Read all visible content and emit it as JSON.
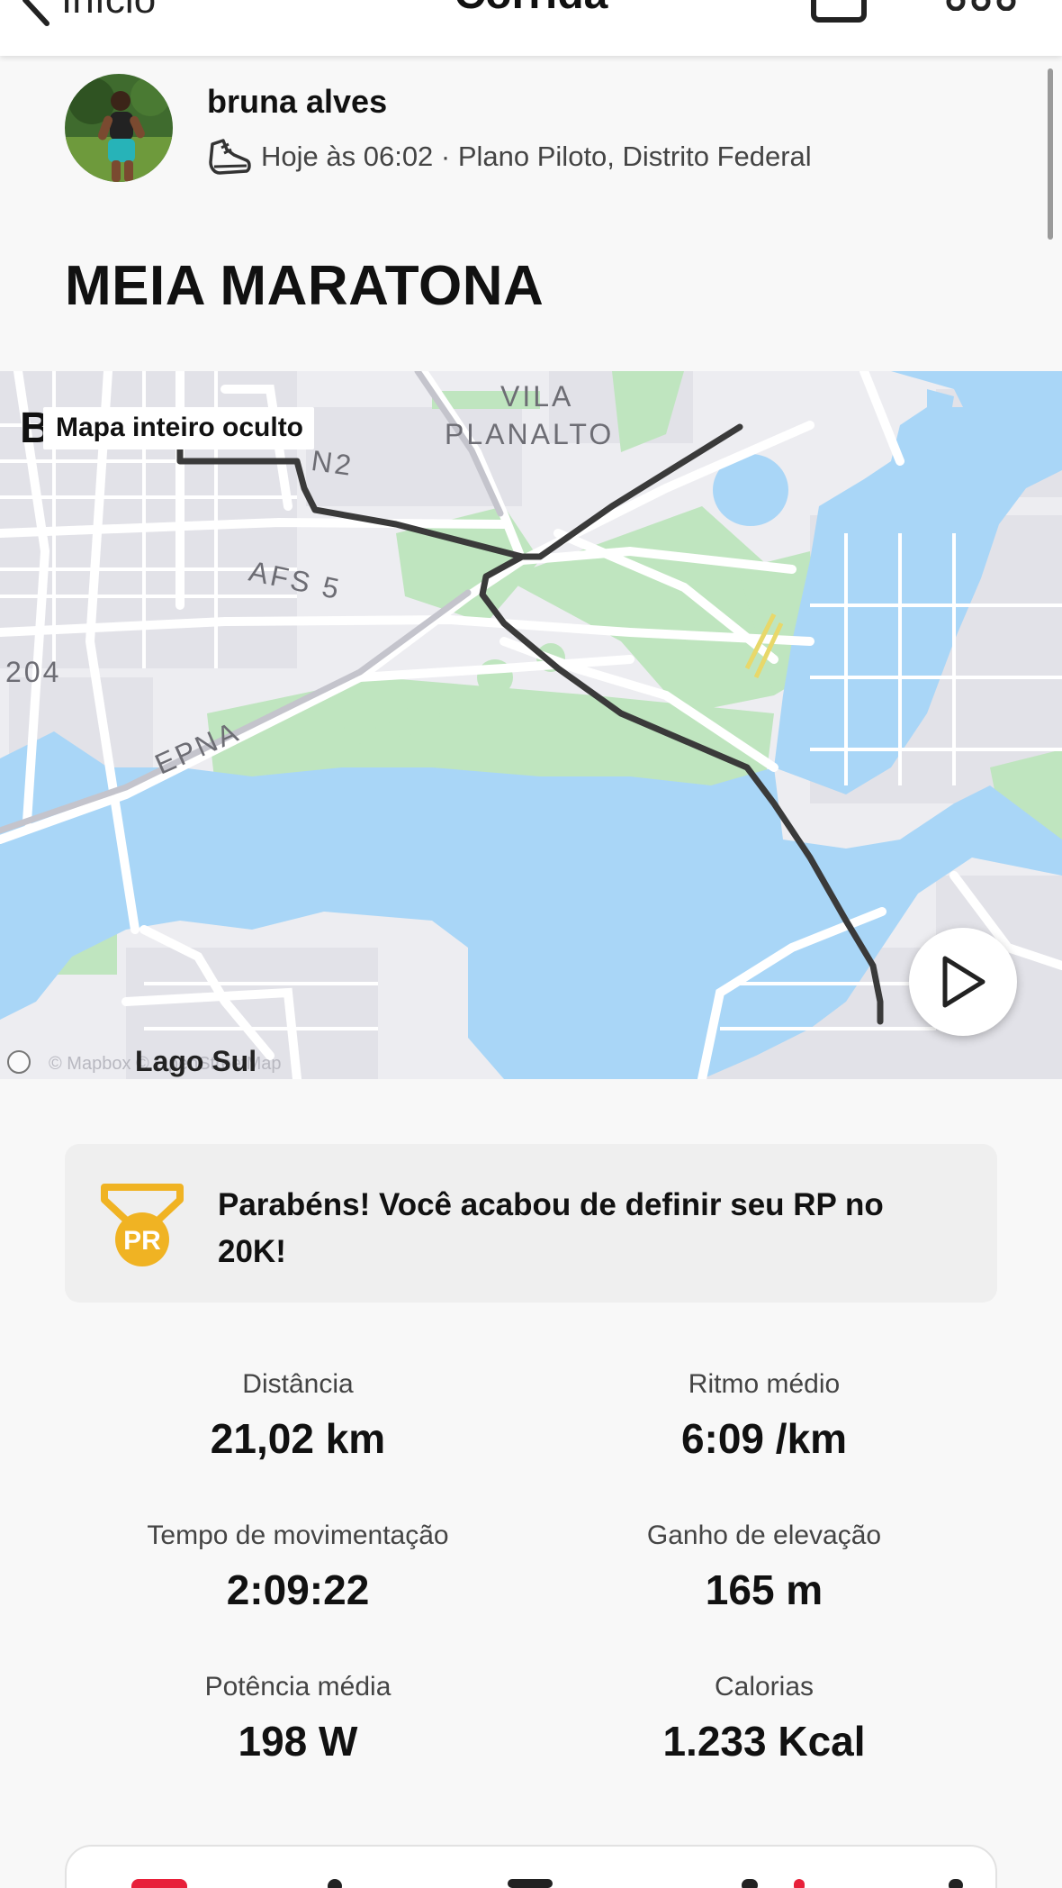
{
  "header": {
    "back_label": "Início",
    "title": "Corrida"
  },
  "author": {
    "name": "bruna alves",
    "meta": "Hoje às 06:02 · Plano Piloto, Distrito Federal"
  },
  "activity": {
    "title": "MEIA MARATONA"
  },
  "map": {
    "hidden_badge": "Mapa inteiro oculto",
    "city_fragment": "B",
    "labels": {
      "vila": "VILA",
      "planalto": "PLANALTO",
      "n2": "N2",
      "afs5": "AFS 5",
      "n204": "204",
      "epna": "EPNA",
      "lago_sul": "Lago Sul"
    },
    "attribution": "© Mapbox © OpenStreetMap",
    "colors": {
      "water": "#a9d6f7",
      "park": "#bfe5bf",
      "route": "#3a3a3a"
    }
  },
  "achievement": {
    "badge_text": "PR",
    "message": "Parabéns! Você acabou de definir seu RP no 20K!",
    "badge_color": "#f0b323"
  },
  "stats": [
    {
      "label": "Distância",
      "value": "21,02 km"
    },
    {
      "label": "Ritmo médio",
      "value": "6:09 /km"
    },
    {
      "label": "Tempo de movimentação",
      "value": "2:09:22"
    },
    {
      "label": "Ganho de elevação",
      "value": "165 m"
    },
    {
      "label": "Potência média",
      "value": "198 W"
    },
    {
      "label": "Calorias",
      "value": "1.233 Kcal"
    }
  ]
}
